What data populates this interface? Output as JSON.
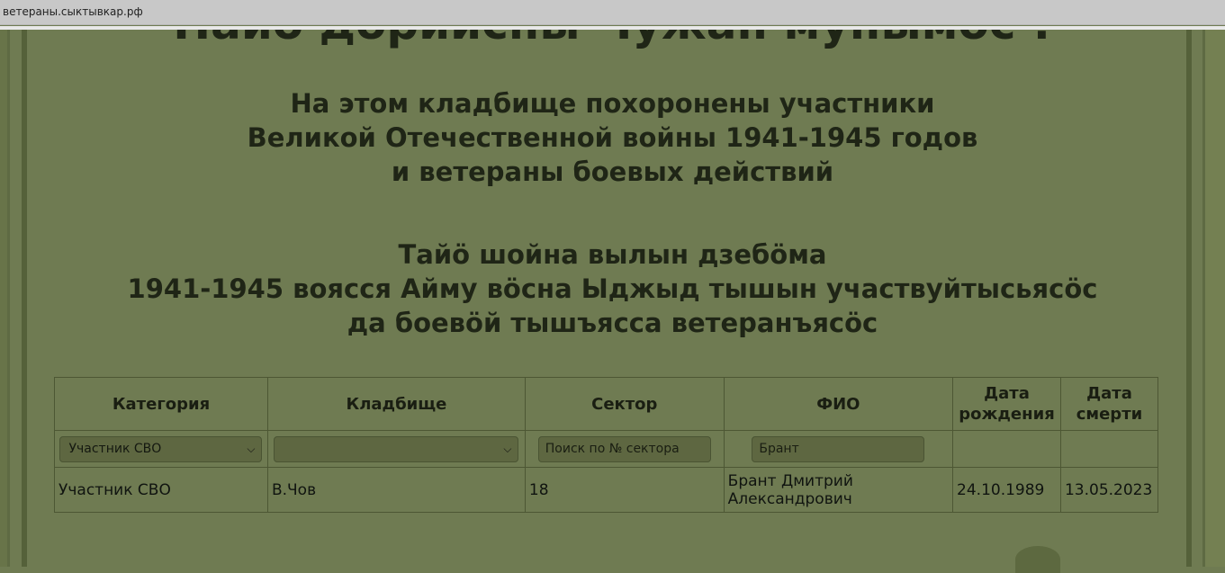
{
  "browser": {
    "url": "ветераны.сыктывкар.рф"
  },
  "page": {
    "title_top": "Найо дорийсны Чужан мунымос !",
    "heading_ru": [
      "На этом кладбище похоронены участники",
      "Великой Отечественной войны 1941-1945 годов",
      "и ветераны боевых действий"
    ],
    "heading_komi": [
      "Тайӧ шойна вылын дзебӧма",
      "1941-1945 воясся Айму вӧсна Ыджыд тышын участвуйтысьясӧс",
      "да боевӧй тышъясса ветеранъясӧс"
    ]
  },
  "table": {
    "headers": {
      "category": "Категория",
      "cemetery": "Кладбище",
      "sector": "Сектор",
      "fio": "ФИО",
      "birth_1": "Дата",
      "birth_2": "рождения",
      "death_1": "Дата",
      "death_2": "смерти"
    },
    "filters": {
      "category_value": "Участник СВО",
      "cemetery_value": "",
      "sector_placeholder": "Поиск по № сектора",
      "fio_value": "Брант"
    },
    "rows": [
      {
        "category": "Участник СВО",
        "cemetery": "В.Чов",
        "sector": "18",
        "fio_1": "Брант Дмитрий",
        "fio_2": "Александрович",
        "birth": "24.10.1989",
        "death": "13.05.2023"
      }
    ]
  }
}
